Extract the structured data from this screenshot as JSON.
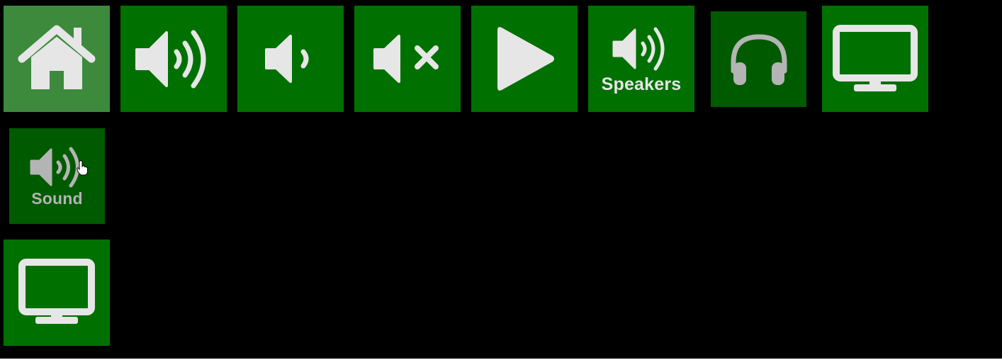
{
  "colors": {
    "background": "#000000",
    "tile_green": "#007000",
    "tile_dim": "#005a00",
    "tile_highlight": "#3d8a3d",
    "icon_light": "#e6e6e6",
    "icon_dim": "#b4b4b4"
  },
  "tiles": {
    "home": {
      "icon": "home-icon"
    },
    "volume_up": {
      "icon": "speaker-loud-icon"
    },
    "volume_down": {
      "icon": "speaker-quiet-icon"
    },
    "mute": {
      "icon": "speaker-mute-icon"
    },
    "play": {
      "icon": "play-icon"
    },
    "speakers": {
      "icon": "speaker-loud-icon",
      "label": "Speakers"
    },
    "headphones": {
      "icon": "headphones-icon"
    },
    "monitor_top": {
      "icon": "monitor-icon"
    },
    "sound": {
      "icon": "speaker-loud-icon",
      "label": "Sound"
    },
    "monitor_bottom": {
      "icon": "monitor-icon"
    }
  }
}
